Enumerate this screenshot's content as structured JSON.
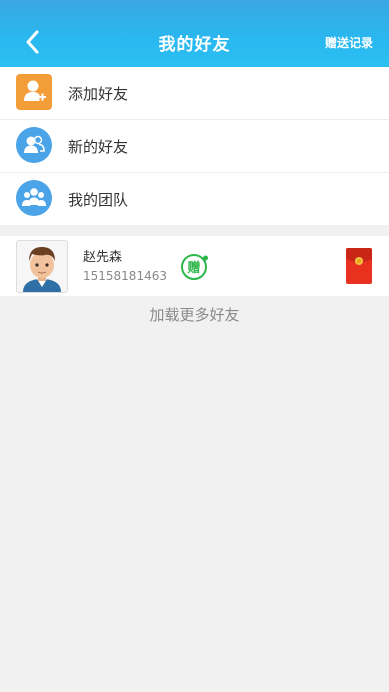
{
  "header": {
    "title": "我的好友",
    "action_label": "赠送记录",
    "back_icon": "chevron-left-icon"
  },
  "menu": {
    "items": [
      {
        "label": "添加好友",
        "icon": "add-user-icon",
        "color": "#f29d38"
      },
      {
        "label": "新的好友",
        "icon": "new-friends-icon",
        "color": "#4ba3e8"
      },
      {
        "label": "我的团队",
        "icon": "team-icon",
        "color": "#4ba3e8"
      }
    ]
  },
  "friends": [
    {
      "name": "赵先森",
      "phone": "15158181463",
      "gift_icon_text": "赠",
      "gift_icon": "gift-icon",
      "redpacket_icon": "red-packet-icon"
    }
  ],
  "load_more": "加载更多好友",
  "colors": {
    "header_top": "#3aa6e2",
    "header_bottom": "#2cc0f2",
    "gift_green": "#2db64a",
    "red_packet": "#e8321f",
    "background": "#f1f1f1"
  }
}
